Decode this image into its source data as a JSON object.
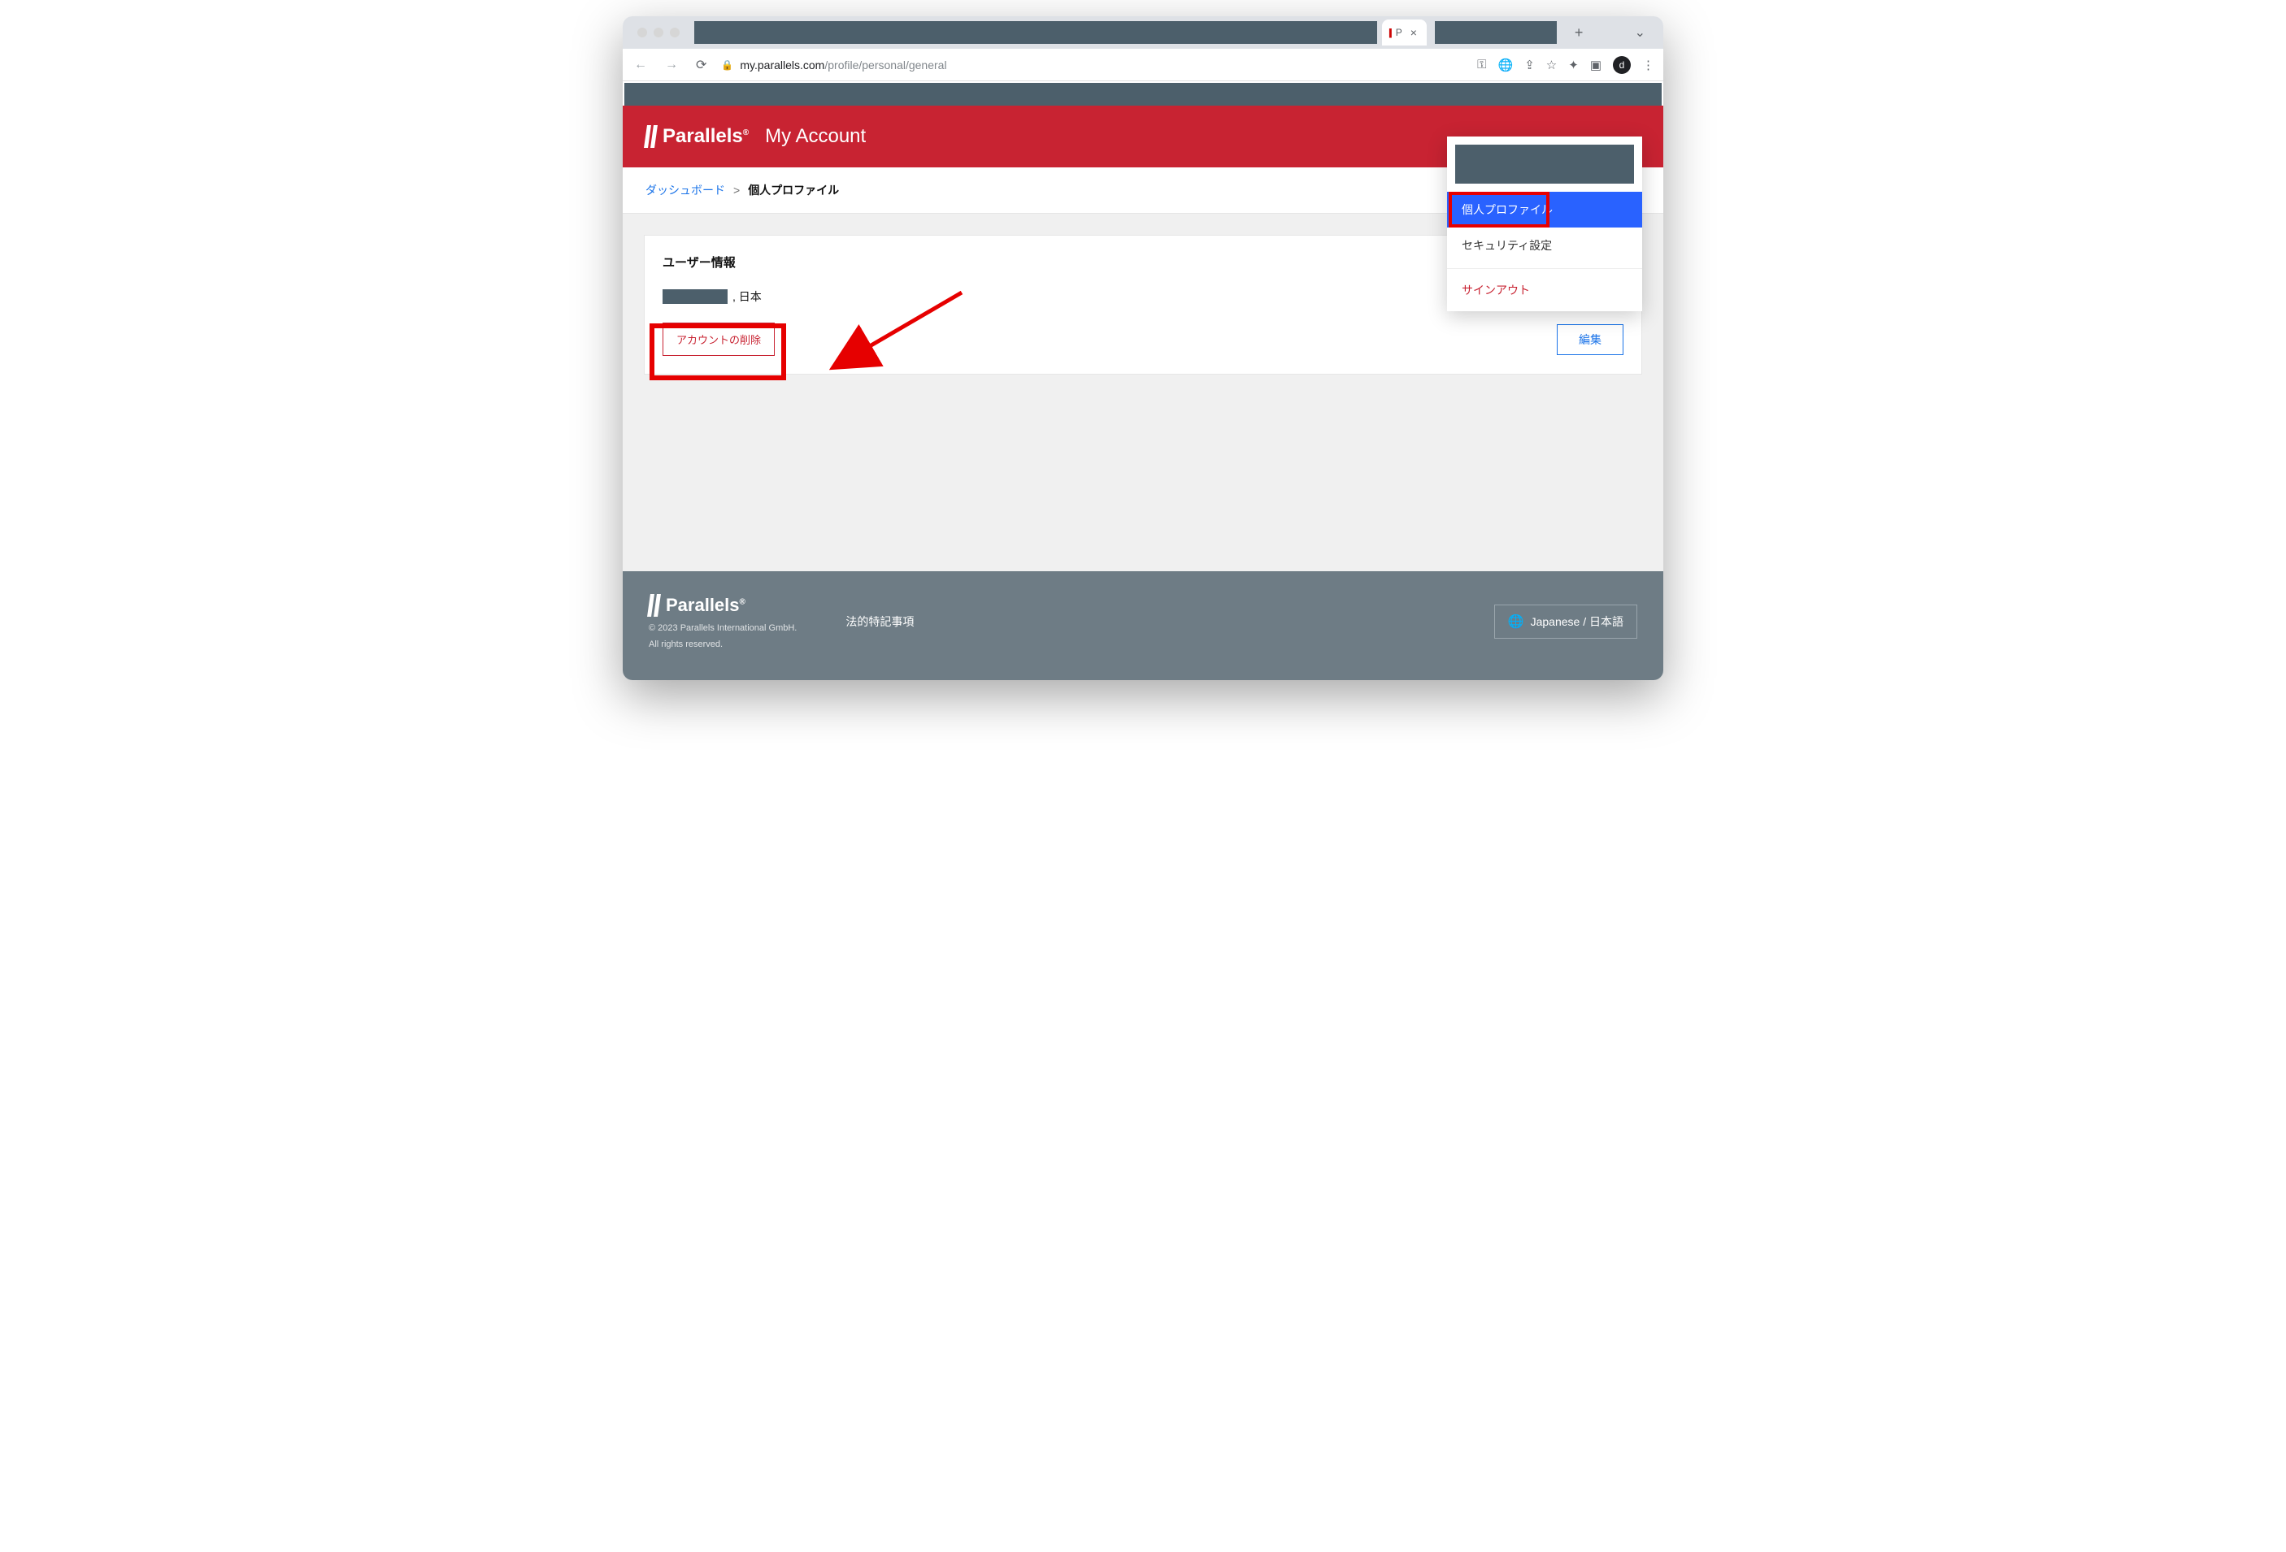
{
  "browser": {
    "active_tab_title": "P",
    "url_host": "my.parallels.com",
    "url_path": "/profile/personal/general",
    "avatar_letter": "d"
  },
  "header": {
    "logo_text": "Parallels",
    "subtitle": "My Account"
  },
  "breadcrumb": {
    "dashboard": "ダッシュボード",
    "sep": ">",
    "current": "個人プロファイル"
  },
  "card": {
    "title": "ユーザー情報",
    "country_suffix": ", 日本",
    "delete_label": "アカウントの削除",
    "edit_label": "編集"
  },
  "menu": {
    "personal_profile": "個人プロファイル",
    "security_settings": "セキュリティ設定",
    "sign_out": "サインアウト"
  },
  "footer": {
    "legal": "法的特記事項",
    "copyright": "© 2023 Parallels International GmbH.",
    "rights": "All rights reserved.",
    "language": "Japanese / 日本語"
  }
}
